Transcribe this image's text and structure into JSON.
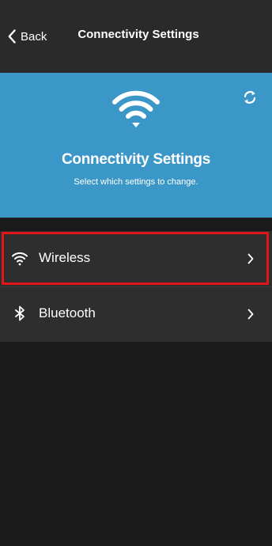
{
  "navbar": {
    "back_label": "Back",
    "title": "Connectivity Settings"
  },
  "header": {
    "icon": "wifi-icon",
    "title": "Connectivity Settings",
    "subtitle": "Select which settings to change.",
    "refresh_icon": "refresh-icon",
    "background_color": "#3b97c7"
  },
  "list": {
    "items": [
      {
        "icon": "wifi-icon",
        "label": "Wireless",
        "highlighted": true
      },
      {
        "icon": "bluetooth-icon",
        "label": "Bluetooth",
        "highlighted": false
      }
    ]
  },
  "colors": {
    "highlight": "#e0161b",
    "navbar_bg": "#2a2a2a",
    "list_bg": "#2e2e2e",
    "screen_bg": "#1a1a1a"
  }
}
